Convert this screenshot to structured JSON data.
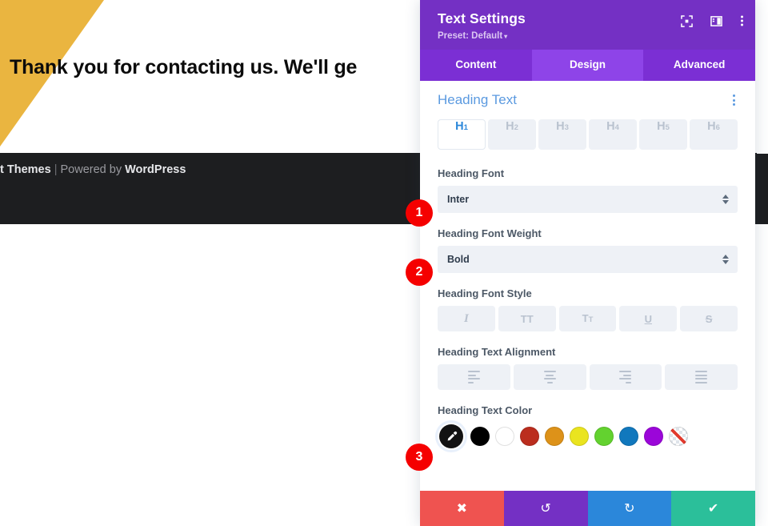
{
  "page": {
    "hero_heading": "Thank you for contacting us. We'll ge",
    "footer_prefix": "t Themes",
    "footer_separator": "|",
    "footer_middle": "Powered by",
    "footer_brand": "WordPress"
  },
  "panel": {
    "title": "Text Settings",
    "preset": "Preset: Default",
    "preset_caret": "▾",
    "header_icons": [
      {
        "name": "focus-target-icon",
        "label": "Focus"
      },
      {
        "name": "layout-panel-icon",
        "label": "Layout"
      },
      {
        "name": "more-options-icon",
        "label": "More"
      }
    ],
    "tabs": [
      {
        "label": "Content",
        "active": false
      },
      {
        "label": "Design",
        "active": true
      },
      {
        "label": "Advanced",
        "active": false
      }
    ],
    "section": {
      "title": "Heading Text",
      "heading_levels": [
        {
          "label": "H",
          "sub": "1",
          "active": true
        },
        {
          "label": "H",
          "sub": "2",
          "active": false
        },
        {
          "label": "H",
          "sub": "3",
          "active": false
        },
        {
          "label": "H",
          "sub": "4",
          "active": false
        },
        {
          "label": "H",
          "sub": "5",
          "active": false
        },
        {
          "label": "H",
          "sub": "6",
          "active": false
        }
      ],
      "heading_font": {
        "label": "Heading Font",
        "value": "Inter"
      },
      "heading_font_weight": {
        "label": "Heading Font Weight",
        "value": "Bold"
      },
      "heading_font_style": {
        "label": "Heading Font Style",
        "options": [
          {
            "name": "italic",
            "glyph": "I"
          },
          {
            "name": "uppercase",
            "glyph": "TT"
          },
          {
            "name": "small-caps",
            "glyph": "T",
            "glyph_small": "T"
          },
          {
            "name": "underline",
            "glyph": "U"
          },
          {
            "name": "strikethrough",
            "glyph": "S"
          }
        ]
      },
      "heading_text_alignment": {
        "label": "Heading Text Alignment",
        "options": [
          {
            "name": "align-left"
          },
          {
            "name": "align-center"
          },
          {
            "name": "align-right"
          },
          {
            "name": "align-justify"
          }
        ]
      },
      "heading_text_color": {
        "label": "Heading Text Color",
        "selected_tool": "eyedropper",
        "swatches": [
          {
            "name": "black",
            "hex": "#000000"
          },
          {
            "name": "white",
            "hex": "#ffffff"
          },
          {
            "name": "dark-red",
            "hex": "#bb2d1e"
          },
          {
            "name": "orange",
            "hex": "#dd9219"
          },
          {
            "name": "yellow",
            "hex": "#eae41f"
          },
          {
            "name": "green",
            "hex": "#63d22f"
          },
          {
            "name": "blue",
            "hex": "#1178bd"
          },
          {
            "name": "purple",
            "hex": "#9b06d9"
          },
          {
            "name": "none",
            "hex": "transparent"
          }
        ]
      }
    },
    "actions": [
      {
        "name": "cancel",
        "glyph": "✖",
        "color": "#ef5350"
      },
      {
        "name": "undo",
        "glyph": "↺",
        "color": "#7430c4"
      },
      {
        "name": "redo",
        "glyph": "↻",
        "color": "#2b87da"
      },
      {
        "name": "save",
        "glyph": "✔",
        "color": "#2bbf9a"
      }
    ]
  },
  "annotations": {
    "badge_1": "1",
    "badge_2": "2",
    "badge_3": "3"
  },
  "colors": {
    "panel_header": "#7430c4",
    "tab_active": "#8e44e8",
    "tab_inactive": "#7b2fd4",
    "section_title": "#5b9ae0",
    "accent_blue": "#2b87da",
    "badge_red": "#f50000",
    "page_yellow": "#eab540",
    "footer_dark": "#1d1e20"
  }
}
